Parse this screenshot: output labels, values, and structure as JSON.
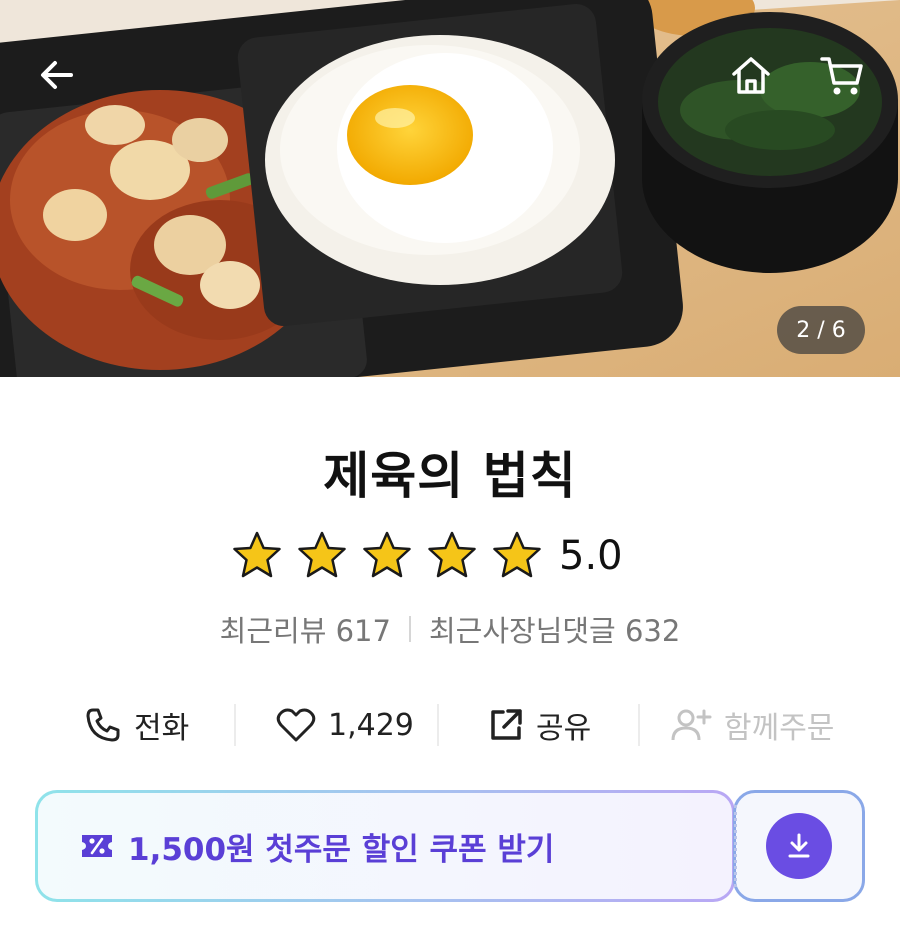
{
  "hero": {
    "image_alt": "food-photo",
    "counter": "2 / 6"
  },
  "store": {
    "name": "제육의 법칙",
    "rating": "5.0",
    "stars": 5
  },
  "reviews": {
    "recent_review": "최근리뷰 617",
    "owner_reply": "최근사장님댓글 632"
  },
  "actions": {
    "call": "전화",
    "likes": "1,429",
    "share": "공유",
    "group_order": "함께주문"
  },
  "coupon": {
    "label": "1,500원 첫주문 할인 쿠폰 받기"
  },
  "colors": {
    "accent": "#6a4de3",
    "coupon_text": "#5a3fd6",
    "star": "#f5c518"
  }
}
